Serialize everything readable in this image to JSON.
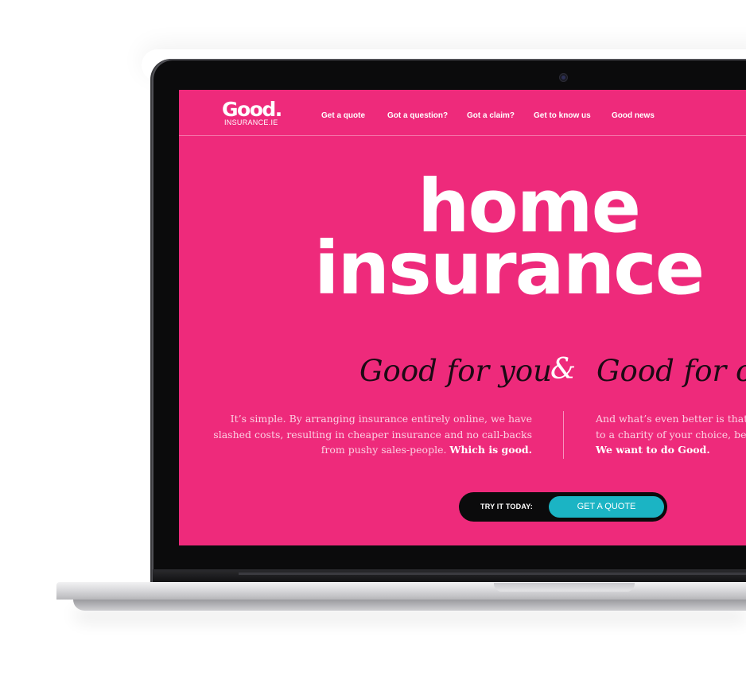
{
  "site": {
    "logo": {
      "main": "Good.",
      "sub": "INSURANCE.IE"
    },
    "nav": [
      {
        "label": "Get a quote"
      },
      {
        "label": "Got a question?"
      },
      {
        "label": "Got a claim?"
      },
      {
        "label": "Get to know us"
      },
      {
        "label": "Good news"
      }
    ],
    "headline": {
      "line1": "home",
      "line2": "insurance"
    },
    "tagline": {
      "left": "Good for you",
      "amp": "&",
      "right": "Good for others"
    },
    "copy_left": {
      "line1": "It’s simple. By arranging insurance entirely online, we have",
      "line2": "slashed costs, resulting in cheaper insurance and no call-backs",
      "line3": "from pushy sales-people.",
      "emphasis": "Which is good."
    },
    "copy_right": {
      "line1": "And what’s even better is that",
      "line2": "to a charity of your choice, bec",
      "emphasis": "We want to do Good."
    },
    "cta": {
      "label": "TRY IT TODAY:",
      "button": "GET A QUOTE"
    },
    "colors": {
      "brand_pink": "#ee2a7b",
      "cta_teal": "#1bb4c4",
      "cta_bg": "#0b0b0c"
    }
  }
}
